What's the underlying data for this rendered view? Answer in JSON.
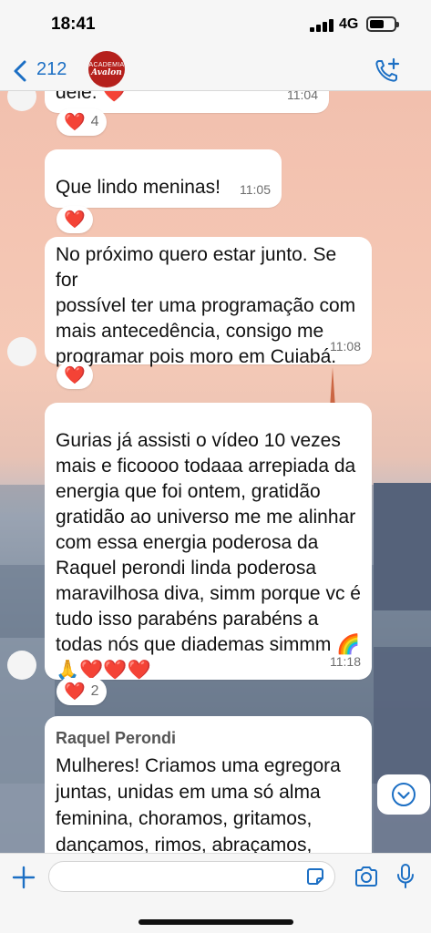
{
  "status_bar": {
    "time": "18:41",
    "network": "4G"
  },
  "header": {
    "back_count": "212",
    "avatar_line1": "ACADEMIA",
    "avatar_line2": "Avalon"
  },
  "messages": [
    {
      "text": "dele. ❤️",
      "time": "11:04",
      "reaction": "❤️",
      "reaction_count": "4"
    },
    {
      "text": "Que lindo meninas!",
      "time": "11:05",
      "reaction": "❤️"
    },
    {
      "text": "No próximo quero estar junto. Se for\npossível ter uma programação com\nmais antecedência, consigo me\nprogramar pois moro em Cuiabá.",
      "time": "11:08",
      "reaction": "❤️"
    },
    {
      "text": "Gurias já assisti o vídeo 10 vezes\nmais e ficoooo todaaa arrepiada da\nenergia que foi ontem, gratidão\ngratidão ao universo me me alinhar\ncom essa energia poderosa da\nRaquel perondi linda poderosa\nmaravilhosa diva, simm porque vc é\ntudo isso parabéns parabéns a\ntodas nós que diademas simmm 🌈\n🙏❤️❤️❤️",
      "time": "11:18",
      "reaction": "❤️",
      "reaction_count": "2"
    },
    {
      "sender": "Raquel Perondi",
      "text": "Mulheres! Criamos uma egregora\njuntas, unidas em uma só alma\nfeminina, choramos, gritamos,\ndançamos, rimos, abraçamos,\naprendemos, curamos, libertamos"
    }
  ],
  "input": {
    "placeholder": ""
  },
  "icons": {
    "back": "chevron-left-icon",
    "call": "add-call-icon",
    "scroll": "chevron-down-icon",
    "plus": "plus-icon",
    "sticker": "sticker-icon",
    "camera": "camera-icon",
    "mic": "microphone-icon"
  },
  "colors": {
    "accent": "#1c6fc4",
    "heart": "#e0202e",
    "avatar_bg": "#b5201c",
    "bubble": "#ffffff"
  }
}
